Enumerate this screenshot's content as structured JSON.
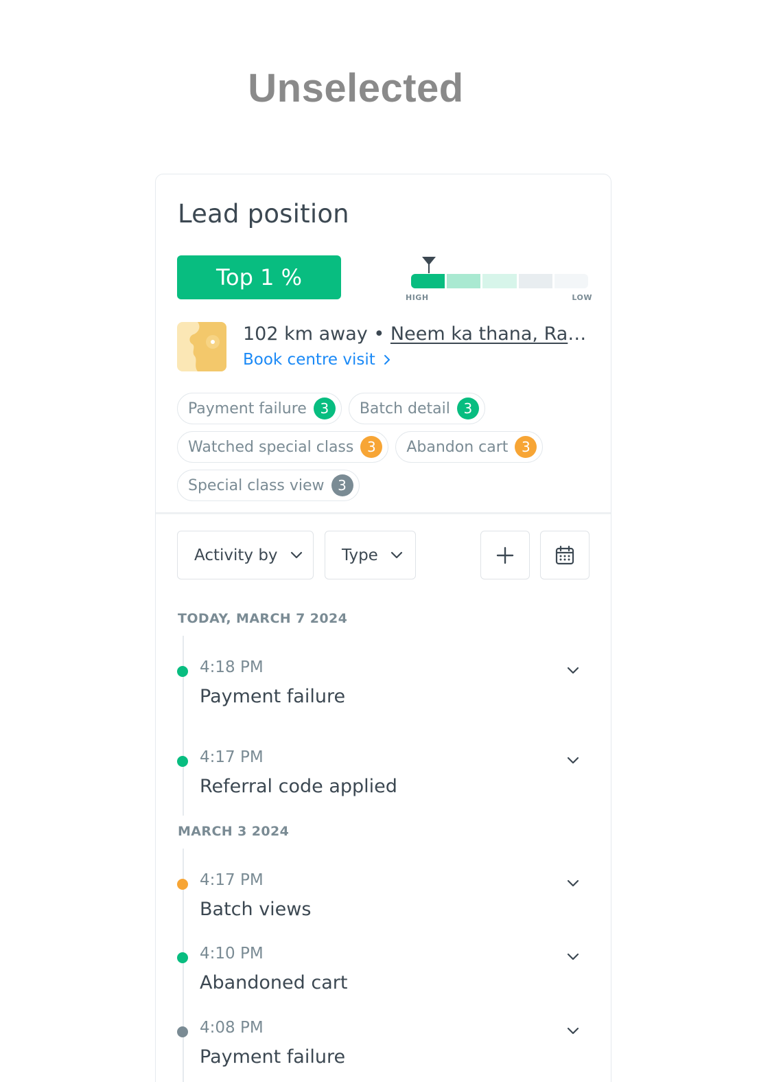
{
  "page": {
    "heading": "Unselected"
  },
  "card": {
    "title": "Lead position",
    "rank": {
      "label": "Top 1 %",
      "color": "#08bd80"
    },
    "meter": {
      "high_label": "HIGH",
      "low_label": "LOW",
      "position_fraction": 0.01,
      "segment_colors": [
        "#08bd80",
        "#a9e9d1",
        "#d7f5ea",
        "#e8edf0",
        "#f3f6f8"
      ]
    },
    "location": {
      "distance": "102 km away",
      "separator": "•",
      "city": "Neem ka thana, Rajasthan",
      "action": "Book centre visit",
      "action_icon": "chevron-right-icon",
      "thumb_icon": "map-icon"
    },
    "tags": [
      [
        {
          "label": "Payment failure",
          "count": "3",
          "color": "#08bd80"
        },
        {
          "label": "Batch detail",
          "count": "3",
          "color": "#08bd80"
        }
      ],
      [
        {
          "label": "Watched special class",
          "count": "3",
          "color": "#f7a535"
        },
        {
          "label": "Abandon cart",
          "count": "3",
          "color": "#f7a535"
        }
      ],
      [
        {
          "label": "Special class view",
          "count": "3",
          "color": "#7a8b94"
        }
      ]
    ],
    "filters": {
      "activity_by": "Activity by",
      "type": "Type",
      "dropdown_icon": "chevron-down-icon",
      "add_icon": "plus-icon",
      "calendar_icon": "calendar-icon"
    },
    "timeline": [
      {
        "date": "TODAY, MARCH 7 2024",
        "events": [
          {
            "time": "4:18 PM",
            "title": "Payment failure",
            "color": "#08bd80"
          },
          {
            "time": "4:17 PM",
            "title": "Referral code applied",
            "color": "#08bd80"
          }
        ]
      },
      {
        "date": "MARCH 3 2024",
        "events": [
          {
            "time": "4:17 PM",
            "title": "Batch views",
            "color": "#f7a535"
          },
          {
            "time": "4:10 PM",
            "title": "Abandoned cart",
            "color": "#08bd80"
          },
          {
            "time": "4:08 PM",
            "title": "Payment failure",
            "color": "#7a8b94"
          }
        ]
      }
    ]
  }
}
